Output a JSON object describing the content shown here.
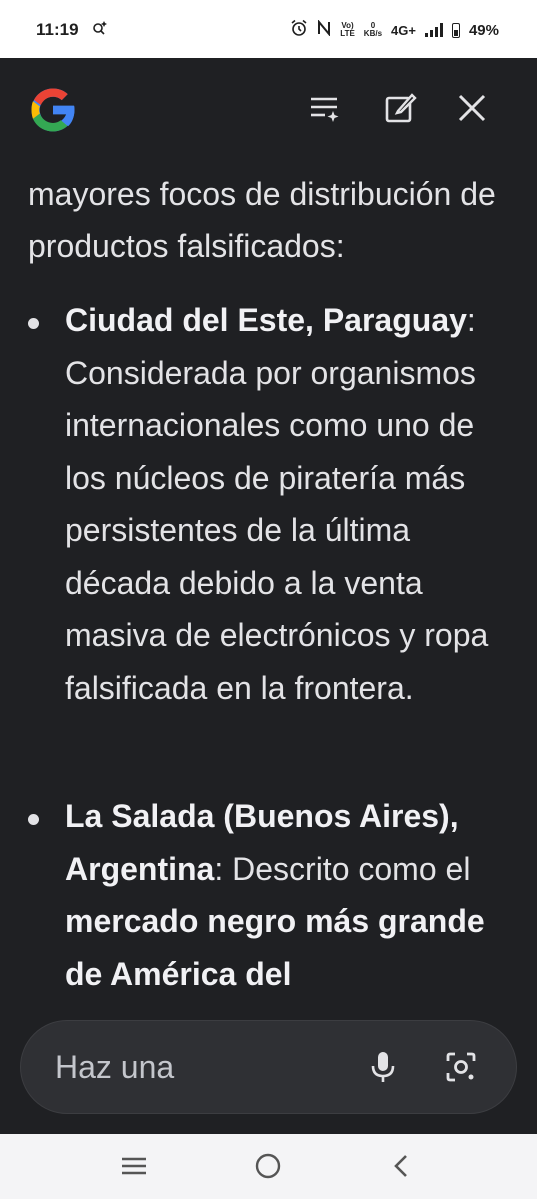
{
  "status_bar": {
    "time": "11:19",
    "network_label_top": "Vo)",
    "network_label_bottom": "LTE",
    "speed_top": "0",
    "speed_bottom": "KB/s",
    "network_type": "4G+",
    "battery": "49%",
    "icons": [
      "search-sparkle-icon",
      "alarm-icon",
      "nfc-icon",
      "signal-icon",
      "battery-icon"
    ]
  },
  "header": {
    "logo": "google-g-logo",
    "icons": [
      "list-sparkle-icon",
      "edit-icon",
      "close-icon"
    ]
  },
  "content": {
    "intro": "mayores focos de distribución de productos falsificados:",
    "bullets": [
      {
        "bold": "Ciudad del Este, Paraguay",
        "rest": ": Considerada por organismos internacionales como uno de los núcleos de piratería más persistentes de la última década debido a la venta masiva de electrónicos y ropa falsificada en la frontera."
      },
      {
        "bold": "La Salada (Buenos Aires), Argentina",
        "mid": ": Descrito como el ",
        "bold2": "mercado negro más grande de América del"
      }
    ]
  },
  "prompt": {
    "placeholder": "Haz una",
    "icons": [
      "mic-icon",
      "lens-icon"
    ]
  },
  "nav": {
    "icons": [
      "recents-icon",
      "home-icon",
      "back-icon"
    ]
  },
  "colors": {
    "background": "#1f2023",
    "text": "#e3e3e6",
    "prompt_bg": "#2f3034"
  }
}
